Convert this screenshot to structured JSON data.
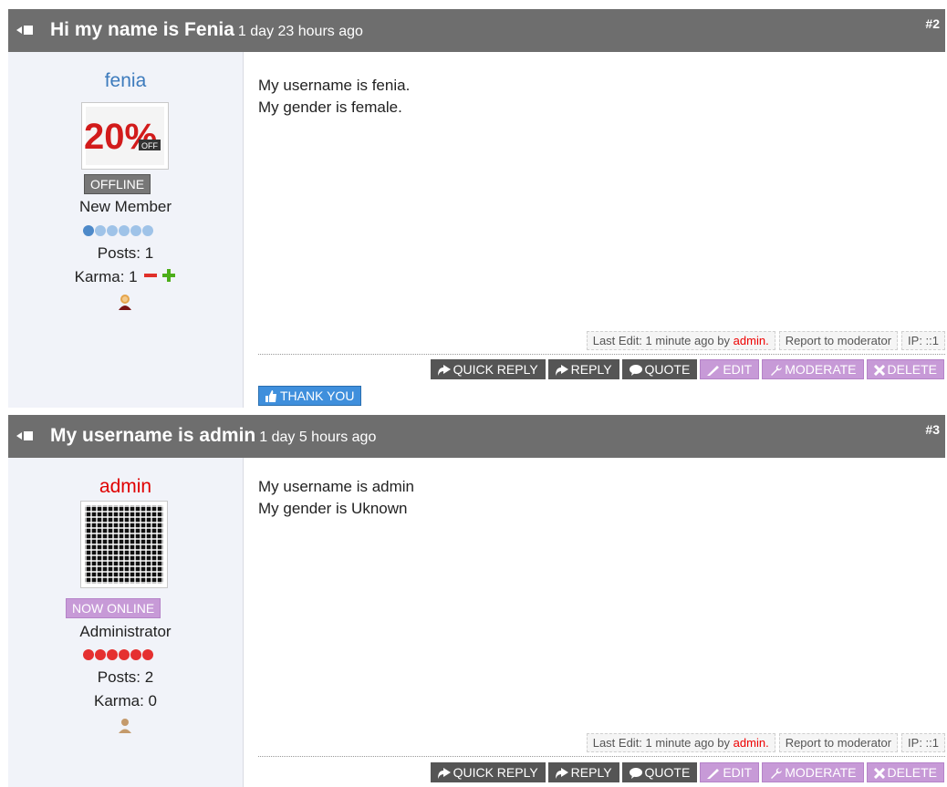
{
  "posts": [
    {
      "title": "Hi my name is Fenia",
      "ago": "1 day 23 hours ago",
      "number": "#2",
      "username": "fenia",
      "username_color": "#3d7bbd",
      "avatar_text": "20%",
      "avatar_subtext": "OFF",
      "status": "OFFLINE",
      "status_color": "#777777",
      "rank": "New Member",
      "rank_star_color": "#9fc3e8",
      "rank_star_active_color": "#4d89c9",
      "posts_label": "Posts: 1",
      "karma_label": "Karma: 1",
      "body_lines": [
        "My username is fenia.",
        "My gender is female."
      ],
      "last_edit_prefix": "Last Edit: 1 minute ago by",
      "last_edit_user": "admin.",
      "report": "Report to moderator",
      "ip": "IP: ::1",
      "buttons": {
        "quick_reply": "QUICK REPLY",
        "reply": "REPLY",
        "quote": "QUOTE",
        "edit": "EDIT",
        "moderate": "MODERATE",
        "delete": "DELETE"
      },
      "thank_you": "THANK YOU"
    },
    {
      "title": "My username is admin",
      "ago": "1 day 5 hours ago",
      "number": "#3",
      "username": "admin",
      "username_color": "#e00000",
      "status": "NOW ONLINE",
      "status_color": "#c79ad7",
      "rank": "Administrator",
      "rank_star_color": "#e53030",
      "posts_label": "Posts: 2",
      "karma_label": "Karma: 0",
      "body_lines": [
        "My username is admin",
        "My gender is Uknown"
      ],
      "last_edit_prefix": "Last Edit: 1 minute ago by",
      "last_edit_user": "admin.",
      "report": "Report to moderator",
      "ip": "IP: ::1",
      "buttons": {
        "quick_reply": "QUICK REPLY",
        "reply": "REPLY",
        "quote": "QUOTE",
        "edit": "EDIT",
        "moderate": "MODERATE",
        "delete": "DELETE"
      }
    }
  ]
}
